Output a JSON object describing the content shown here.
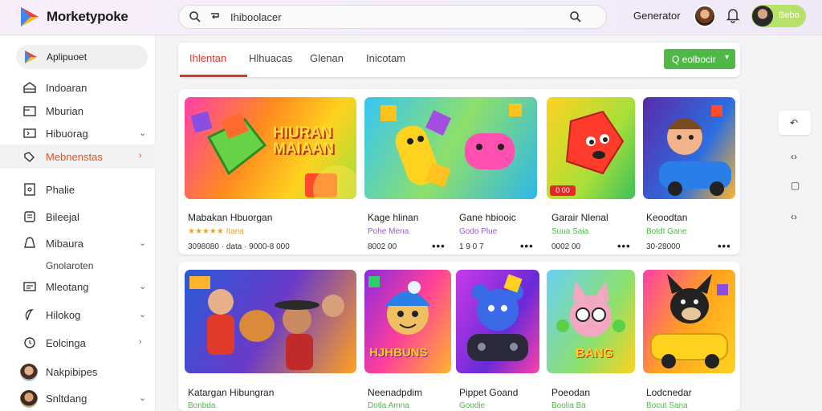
{
  "app": {
    "name": "Morketypoke"
  },
  "search": {
    "value": "Ihiboolacer"
  },
  "header": {
    "action_label": "Generator",
    "user_name": "Bebo"
  },
  "sidebar": {
    "app_label": "Aplipuoet",
    "items": [
      {
        "label": "Indoaran",
        "icon": "home-icon",
        "chevron": false
      },
      {
        "label": "Mburian",
        "icon": "folder-icon",
        "chevron": false
      },
      {
        "label": "Hibuorag",
        "icon": "screen-icon",
        "chevron": true
      },
      {
        "label": "Mebnenstas",
        "icon": "gamepad-icon",
        "chevron": true,
        "active": true
      },
      {
        "label": "Phalie",
        "icon": "tablet-icon",
        "chevron": false
      },
      {
        "label": "Bileejal",
        "icon": "book-icon",
        "chevron": false
      },
      {
        "label": "Mibaura",
        "icon": "bell-icon",
        "chevron": true
      },
      {
        "label": "Gnolaroten",
        "icon": "",
        "chevron": false,
        "sub": true
      },
      {
        "label": "Mleotang",
        "icon": "card-icon",
        "chevron": true
      },
      {
        "label": "Hilokog",
        "icon": "leaf-icon",
        "chevron": true
      },
      {
        "label": "Eolcinga",
        "icon": "clock-icon",
        "chevron": true
      },
      {
        "label": "Nakpibipes",
        "icon": "avatar",
        "chevron": false
      },
      {
        "label": "Snltdang",
        "icon": "avatar",
        "chevron": true
      }
    ]
  },
  "tabs": [
    {
      "label": "Ihlentan",
      "active": true
    },
    {
      "label": "Hlhuacas"
    },
    {
      "label": "Glenan"
    },
    {
      "label": "Inicotam"
    }
  ],
  "tab_action": {
    "label": "Q eolbocir",
    "chevron": "▾"
  },
  "row1": [
    {
      "art": "HIURAN\nMAIAAN",
      "badge": "",
      "title": "Mabakan Hbuorgan",
      "sub": "★★★★★ Itana",
      "sub_color": "#f0a320",
      "meta": "3098080 · data · 9000-8 000",
      "dots": false
    },
    {
      "art": "",
      "badge": "",
      "title": "Kage hlinan",
      "sub": "Pohe Mena",
      "sub_color": "#9b59d0",
      "meta": "8002 00",
      "dots": true
    },
    {
      "art": "",
      "badge": "",
      "title": "Gane hbiooic",
      "sub": "Godo Plue",
      "sub_color": "#9b59d0",
      "meta": "1 9 0 7",
      "dots": true
    },
    {
      "art": "",
      "badge": "0 00",
      "title": "Garair Nlenal",
      "sub": "Suua Saia",
      "sub_color": "#4fb948",
      "meta": "0002 00",
      "dots": true
    },
    {
      "art": "",
      "badge": "",
      "title": "Keoodtan",
      "sub": "Botdt Gane",
      "sub_color": "#4fb948",
      "meta": "30-28000",
      "dots": true
    }
  ],
  "row2": [
    {
      "art": "",
      "title": "Katargan Hibungran",
      "sub": "Bonbda",
      "sub_color": "#4fb948",
      "meta": "",
      "dots": false
    },
    {
      "art": "HJHBUNS",
      "title": "Neenadpdim",
      "sub": "Dotla Amna",
      "sub_color": "#4fb948",
      "meta": "",
      "dots": false
    },
    {
      "art": "",
      "title": "Pippet Goand",
      "sub": "Goodie",
      "sub_color": "#4fb948",
      "meta": "",
      "dots": false
    },
    {
      "art": "BANG",
      "title": "Poeodan",
      "sub": "Boolia Ba",
      "sub_color": "#4fb948",
      "meta": "",
      "dots": false
    },
    {
      "art": "",
      "title": "Lodcnedar",
      "sub": "Bocut Sana",
      "sub_color": "#4fb948",
      "meta": "",
      "dots": false
    }
  ],
  "right_toolbar": [
    "↶",
    "‹›",
    "▢",
    "‹›"
  ]
}
